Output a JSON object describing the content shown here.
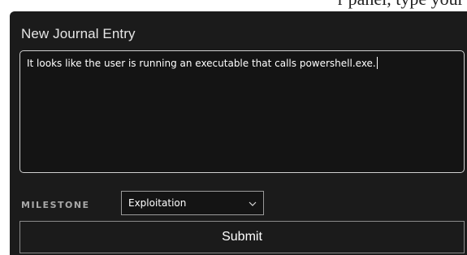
{
  "top_strip": {
    "clipped_text": "r panel, type your"
  },
  "panel": {
    "title": "New Journal Entry",
    "textarea_value": "It looks like the user is running an executable that calls powershell.exe.",
    "milestone_label": "MILESTONE",
    "milestone_selected": "Exploitation",
    "milestone_chevron_icon": "chevron-down-icon",
    "submit_label": "Submit"
  },
  "colors": {
    "panel_background": "#1b1b1b",
    "text_primary": "#ffffff",
    "label_muted": "#a9a9a9",
    "border": "#cfcfcf"
  }
}
